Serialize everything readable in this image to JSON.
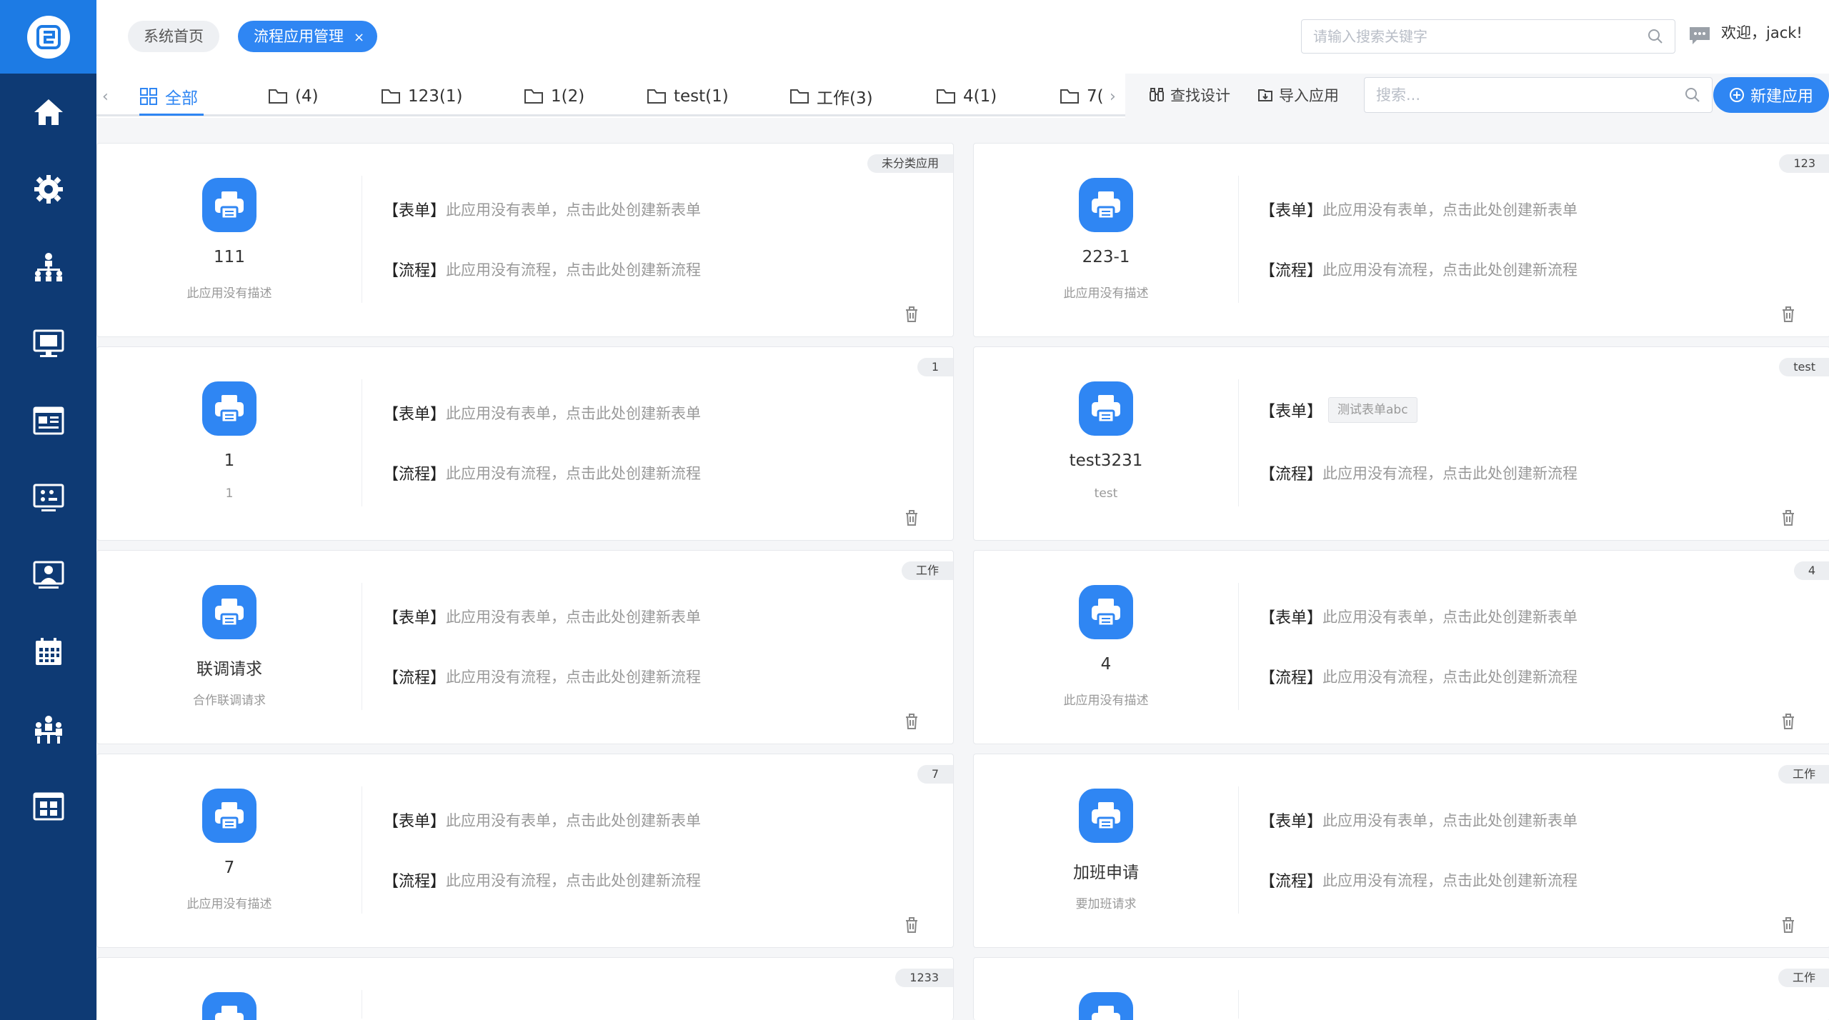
{
  "header": {
    "breadcrumbs": [
      "系统首页",
      "流程应用管理"
    ],
    "close_symbol": "×",
    "search_placeholder": "请输入搜索关键字",
    "welcome": "欢迎，jack!"
  },
  "sidebar": {
    "items": [
      "home-icon",
      "settings-icon",
      "org-chart-icon",
      "monitor-form-icon",
      "news-icon",
      "dashboard-screen-icon",
      "presenter-icon",
      "calendar-icon",
      "meeting-icon",
      "grid-app-icon"
    ]
  },
  "tabs": [
    {
      "label": "全部"
    },
    {
      "label": "(4)"
    },
    {
      "label": "123(1)"
    },
    {
      "label": "1(2)"
    },
    {
      "label": "test(1)"
    },
    {
      "label": "工作(3)"
    },
    {
      "label": "4(1)"
    },
    {
      "label": "7("
    }
  ],
  "toolbar": {
    "find_design": "查找设计",
    "import_app": "导入应用",
    "search_placeholder": "搜索...",
    "new_app": "新建应用"
  },
  "labels": {
    "form": "【表单】",
    "flow": "【流程】",
    "no_form": "此应用没有表单，点击此处创建新表单",
    "no_flow": "此应用没有流程，点击此处创建新流程"
  },
  "cards": [
    {
      "name": "111",
      "desc": "此应用没有描述",
      "badge": "未分类应用",
      "form_tag": ""
    },
    {
      "name": "223-1",
      "desc": "此应用没有描述",
      "badge": "123",
      "form_tag": ""
    },
    {
      "name": "1",
      "desc": "1",
      "badge": "1",
      "form_tag": ""
    },
    {
      "name": "test3231",
      "desc": "test",
      "badge": "test",
      "form_tag": "测试表单abc"
    },
    {
      "name": "联调请求",
      "desc": "合作联调请求",
      "badge": "工作",
      "form_tag": ""
    },
    {
      "name": "4",
      "desc": "此应用没有描述",
      "badge": "4",
      "form_tag": ""
    },
    {
      "name": "7",
      "desc": "此应用没有描述",
      "badge": "7",
      "form_tag": ""
    },
    {
      "name": "加班申请",
      "desc": "要加班请求",
      "badge": "工作",
      "form_tag": ""
    },
    {
      "name": "",
      "desc": "",
      "badge": "1233",
      "form_tag": ""
    },
    {
      "name": "",
      "desc": "",
      "badge": "工作",
      "form_tag": ""
    }
  ],
  "colors": {
    "sidebar": "#0e3a74",
    "accent": "#2f86f3"
  }
}
